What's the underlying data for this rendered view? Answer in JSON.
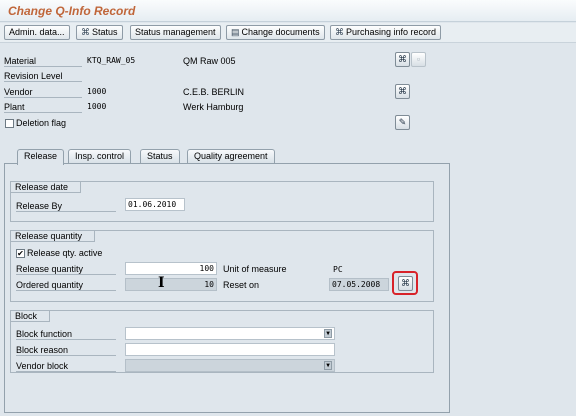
{
  "window": {
    "title": "Change Q-Info Record"
  },
  "toolbar": {
    "admin_label": "Admin. data...",
    "status_label": "Status",
    "status_mgmt_label": "Status management",
    "change_docs_label": "Change documents",
    "purch_info_label": "Purchasing info record"
  },
  "header": {
    "material_label": "Material",
    "material_value": "KTQ_RAW_05",
    "material_desc": "QM Raw 005",
    "revision_label": "Revision Level",
    "vendor_label": "Vendor",
    "vendor_value": "1000",
    "vendor_name": "C.E.B. BERLIN",
    "plant_label": "Plant",
    "plant_value": "1000",
    "plant_name": "Werk Hamburg",
    "deletion_flag_label": "Deletion flag",
    "deletion_flag_checked": false
  },
  "tabs": [
    {
      "label": "Release",
      "active": true
    },
    {
      "label": "Insp. control"
    },
    {
      "label": "Status"
    },
    {
      "label": "Quality agreement"
    }
  ],
  "release_date": {
    "group_title": "Release date",
    "release_by_label": "Release By",
    "release_by_value": "01.06.2010"
  },
  "release_quantity": {
    "group_title": "Release quantity",
    "active_label": "Release qty. active",
    "active_checked": true,
    "quantity_label": "Release quantity",
    "quantity_value": "100",
    "uom_label": "Unit of measure",
    "uom_value": "PC",
    "ordered_label": "Ordered quantity",
    "ordered_value": "10",
    "reset_label": "Reset on",
    "reset_value": "07.05.2008"
  },
  "block": {
    "group_title": "Block",
    "function_label": "Block function",
    "function_value": "",
    "reason_label": "Block reason",
    "reason_value": "",
    "vendor_block_label": "Vendor block",
    "vendor_block_value": ""
  },
  "icons": {
    "glasses": "⌘",
    "edit": "✎",
    "dropdown": "▼"
  },
  "colors": {
    "title": "#c0663a",
    "highlight_ring": "#d8232a",
    "background": "#dfe6ec"
  }
}
